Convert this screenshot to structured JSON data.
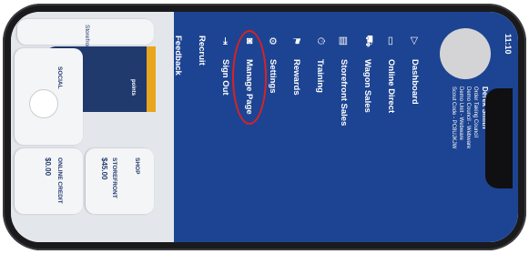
{
  "status": {
    "time": "11:10"
  },
  "profile": {
    "name": "Derek Smith",
    "lines": [
      "Order Taking Council",
      "Demo Council - Webware",
      "Demo Unit - Webware",
      "Scout Code - PC8UJKJW"
    ]
  },
  "menu": {
    "items": [
      {
        "label": "Dashboard",
        "icon": "dashboard-icon",
        "glyph": "▷"
      },
      {
        "label": "Online Direct",
        "icon": "online-direct-icon",
        "glyph": "▭"
      },
      {
        "label": "Wagon Sales",
        "icon": "wagon-icon",
        "glyph": "⛟"
      },
      {
        "label": "Storefront Sales",
        "icon": "storefront-icon",
        "glyph": "▤"
      },
      {
        "label": "Training",
        "icon": "training-icon",
        "glyph": "⏱"
      },
      {
        "label": "Rewards",
        "icon": "rewards-icon",
        "glyph": "⚑"
      },
      {
        "label": "Settings",
        "icon": "gear-icon",
        "glyph": "⚙"
      },
      {
        "label": "Manage Page",
        "icon": "manage-page-icon",
        "glyph": "◙"
      },
      {
        "label": "Sign Out",
        "icon": "sign-out-icon",
        "glyph": "⇥"
      },
      {
        "label": "Recruit",
        "icon": "recruit-icon",
        "glyph": ""
      },
      {
        "label": "Feedback",
        "icon": "feedback-icon",
        "glyph": ""
      }
    ]
  },
  "background": {
    "storefront_card": {
      "label": "STOREFRONT",
      "value": "$45.00"
    },
    "online_card": {
      "label": "ONLINE CREDIT",
      "value": "$0.00"
    },
    "social_label": "SOCIAL",
    "shop_label": "SHOP",
    "points_label": "points",
    "storefront_bottom": "Storefront"
  },
  "colors": {
    "menu_bg": "#1d4492",
    "highlight": "#e02020"
  }
}
